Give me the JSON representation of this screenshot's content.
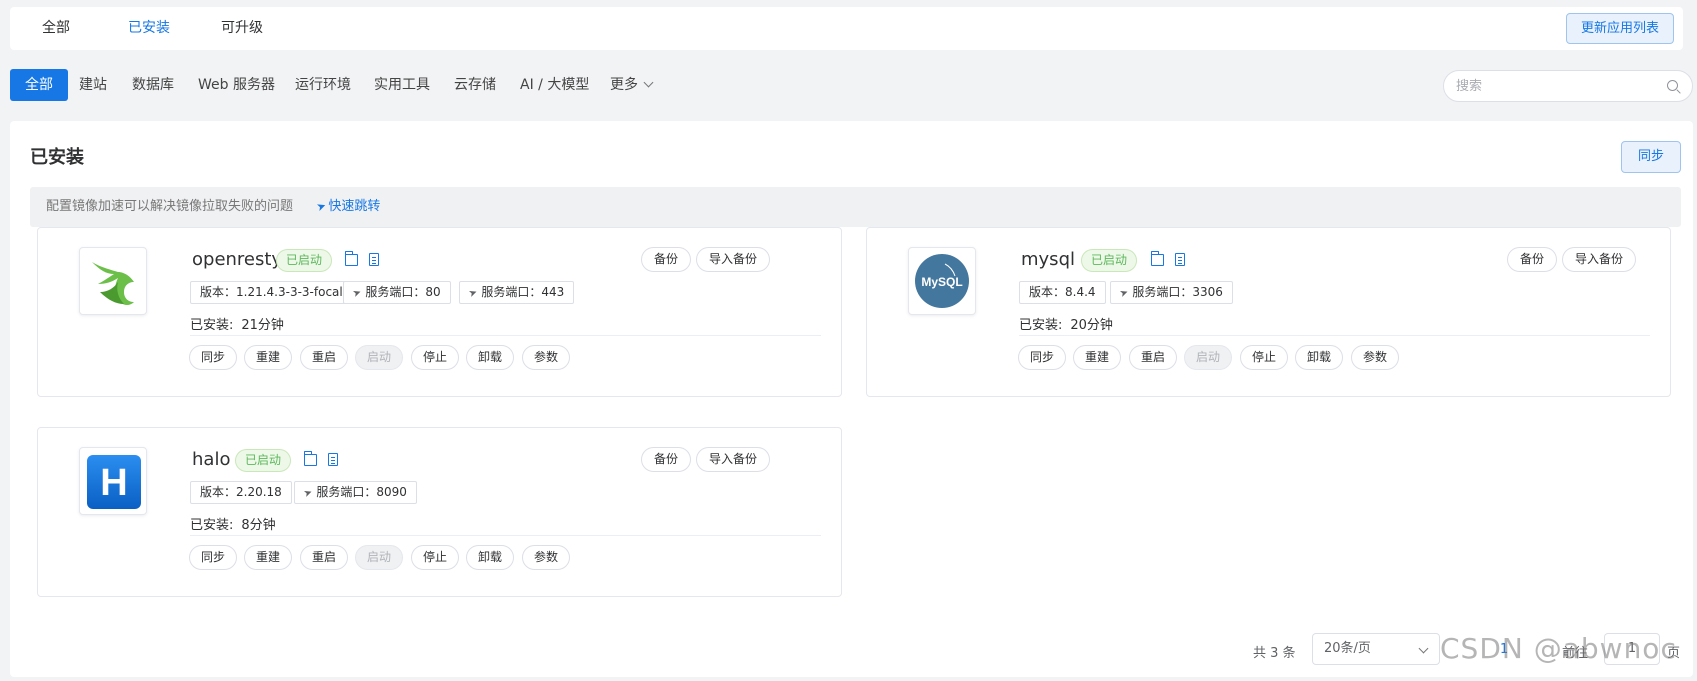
{
  "top_tabs": [
    "全部",
    "已安装",
    "可升级"
  ],
  "update_button": "更新应用列表",
  "categories": [
    "全部",
    "建站",
    "数据库",
    "Web 服务器",
    "运行环境",
    "实用工具",
    "云存储",
    "AI / 大模型",
    "更多"
  ],
  "search": {
    "placeholder": "搜索"
  },
  "panel": {
    "title": "已安装",
    "sync_button": "同步",
    "notice_text": "配置镜像加速可以解决镜像拉取失败的问题",
    "notice_link": "快速跳转"
  },
  "labels": {
    "backup": "备份",
    "import_backup": "导入备份",
    "installed_prefix": "已安装:",
    "actions": [
      "同步",
      "重建",
      "重启",
      "启动",
      "停止",
      "卸载",
      "参数"
    ]
  },
  "apps": [
    {
      "name": "openresty",
      "status": "已启动",
      "version": "版本：1.21.4.3-3-3-focal",
      "ports": [
        "服务端口：80",
        "服务端口：443"
      ],
      "installed": "21分钟",
      "logo": "openresty-logo"
    },
    {
      "name": "mysql",
      "status": "已启动",
      "version": "版本：8.4.4",
      "ports": [
        "服务端口：3306"
      ],
      "installed": "20分钟",
      "logo": "mysql-logo",
      "logo_text": "MySQL"
    },
    {
      "name": "halo",
      "status": "已启动",
      "version": "版本：2.20.18",
      "ports": [
        "服务端口：8090"
      ],
      "installed": "8分钟",
      "logo": "halo-logo",
      "logo_text": "H"
    }
  ],
  "pagination": {
    "total": "共 3 条",
    "page_size": "20条/页",
    "current_page": "1",
    "goto_label": "前往",
    "goto_value": "1",
    "page_suffix": "页"
  },
  "watermark": "CSDN @abwnoc",
  "colors": {
    "primary": "#1677e5",
    "status_green": "#5cb85c"
  }
}
